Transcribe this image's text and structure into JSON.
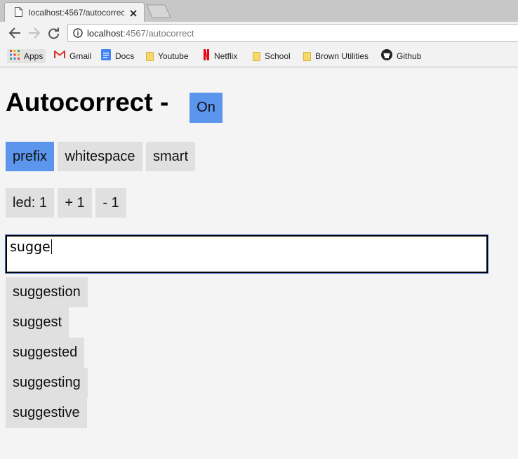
{
  "browser": {
    "tab_title": "localhost:4567/autocorrect",
    "url_host": "localhost",
    "url_rest": ":4567/autocorrect",
    "bookmarks": [
      {
        "label": "Apps",
        "icon": "apps-grid-icon"
      },
      {
        "label": "Gmail",
        "icon": "gmail-icon"
      },
      {
        "label": "Docs",
        "icon": "docs-icon"
      },
      {
        "label": "Youtube",
        "icon": "folder-icon"
      },
      {
        "label": "Netflix",
        "icon": "netflix-icon"
      },
      {
        "label": "School",
        "icon": "folder-icon"
      },
      {
        "label": "Brown Utilities",
        "icon": "folder-icon"
      },
      {
        "label": "Github",
        "icon": "github-icon"
      }
    ]
  },
  "page": {
    "title": "Autocorrect -",
    "toggle_label": "On",
    "modes": [
      {
        "label": "prefix",
        "active": true
      },
      {
        "label": "whitespace",
        "active": false
      },
      {
        "label": "smart",
        "active": false
      }
    ],
    "led_label": "led: 1",
    "increment_label": "+ 1",
    "decrement_label": "- 1",
    "input_value": "sugge",
    "suggestions": [
      "suggestion",
      "suggest",
      "suggested",
      "suggesting",
      "suggestive"
    ]
  },
  "colors": {
    "active_button": "#5b95ec",
    "button": "#e0e0e0",
    "page_background": "#f4f4f4"
  }
}
